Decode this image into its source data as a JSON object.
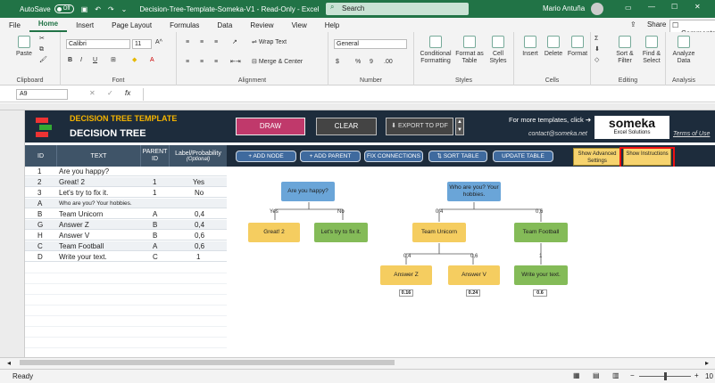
{
  "titlebar": {
    "autosave_label": "AutoSave",
    "autosave_state": "Off",
    "filename": "Decision-Tree-Template-Someka-V1  -  Read-Only  -  Excel",
    "search_placeholder": "Search",
    "user": "Mario Antuña"
  },
  "menu": {
    "items": [
      "File",
      "Home",
      "Insert",
      "Page Layout",
      "Formulas",
      "Data",
      "Review",
      "View",
      "Help"
    ],
    "share": "Share",
    "comments": "Comments"
  },
  "ribbon": {
    "clipboard": {
      "paste": "Paste",
      "label": "Clipboard"
    },
    "font": {
      "family": "Calibri",
      "size": "11",
      "label": "Font"
    },
    "alignment": {
      "wrap": "Wrap Text",
      "merge": "Merge & Center",
      "label": "Alignment"
    },
    "number": {
      "format": "General",
      "label": "Number"
    },
    "styles": {
      "cond": "Conditional Formatting",
      "table": "Format as Table",
      "cell": "Cell Styles",
      "label": "Styles"
    },
    "cells": {
      "insert": "Insert",
      "delete": "Delete",
      "format": "Format",
      "label": "Cells"
    },
    "editing": {
      "sort": "Sort & Filter",
      "find": "Find & Select",
      "label": "Editing"
    },
    "analysis": {
      "analyze": "Analyze Data",
      "label": "Analysis"
    }
  },
  "formula": {
    "namebox": "A9"
  },
  "banner": {
    "template_title": "DECISION TREE TEMPLATE",
    "title": "DECISION TREE",
    "draw": "DRAW",
    "clear": "CLEAR",
    "export": "EXPORT TO PDF",
    "more": "For more templates, click ➔",
    "brand": "someka",
    "brand_sub": "Excel Solutions",
    "contact": "contact@someka.net",
    "terms": "Terms of Use"
  },
  "table": {
    "headers": [
      "ID",
      "TEXT",
      "PARENT ID",
      "Label/Probability",
      "(Optional)"
    ],
    "rows": [
      {
        "id": "1",
        "text": "Are you happy?",
        "parent": "",
        "label": ""
      },
      {
        "id": "2",
        "text": "Great!  2",
        "parent": "1",
        "label": "Yes"
      },
      {
        "id": "3",
        "text": "Let's try to fix it.",
        "parent": "1",
        "label": "No"
      },
      {
        "id": "A",
        "text": "Who are you? Your hobbies.",
        "parent": "",
        "label": ""
      },
      {
        "id": "B",
        "text": "Team Unicorn",
        "parent": "A",
        "label": "0,4"
      },
      {
        "id": "G",
        "text": "Answer Z",
        "parent": "B",
        "label": "0,4"
      },
      {
        "id": "H",
        "text": "Answer V",
        "parent": "B",
        "label": "0,6"
      },
      {
        "id": "C",
        "text": "Team Football",
        "parent": "A",
        "label": "0,6"
      },
      {
        "id": "D",
        "text": "Write your text.",
        "parent": "C",
        "label": "1"
      }
    ]
  },
  "actions": {
    "add_node": "+ ADD NODE",
    "add_parent": "+ ADD PARENT",
    "fix": "FIX CONNECTIONS",
    "sort": "SORT TABLE",
    "update": "UPDATE TABLE",
    "advanced": "Show Advanced Settings",
    "instructions": "Show Instructions"
  },
  "tree": {
    "n1": "Are you happy?",
    "n2": "Great!  2",
    "n3": "Let's try to fix it.",
    "nA": "Who are you? Your hobbies.",
    "nB": "Team Unicorn",
    "nC": "Team Football",
    "nG": "Answer Z",
    "nH": "Answer V",
    "nD": "Write your text.",
    "l_yes": "Yes",
    "l_no": "No",
    "l_b": "0,4",
    "l_c": "0,6",
    "l_g": "0,4",
    "l_h": "0,6",
    "l_d": "1",
    "r_g": "0.16",
    "r_h": "0.24",
    "r_d": "0.6"
  },
  "status": {
    "ready": "Ready",
    "zoom": "10"
  }
}
